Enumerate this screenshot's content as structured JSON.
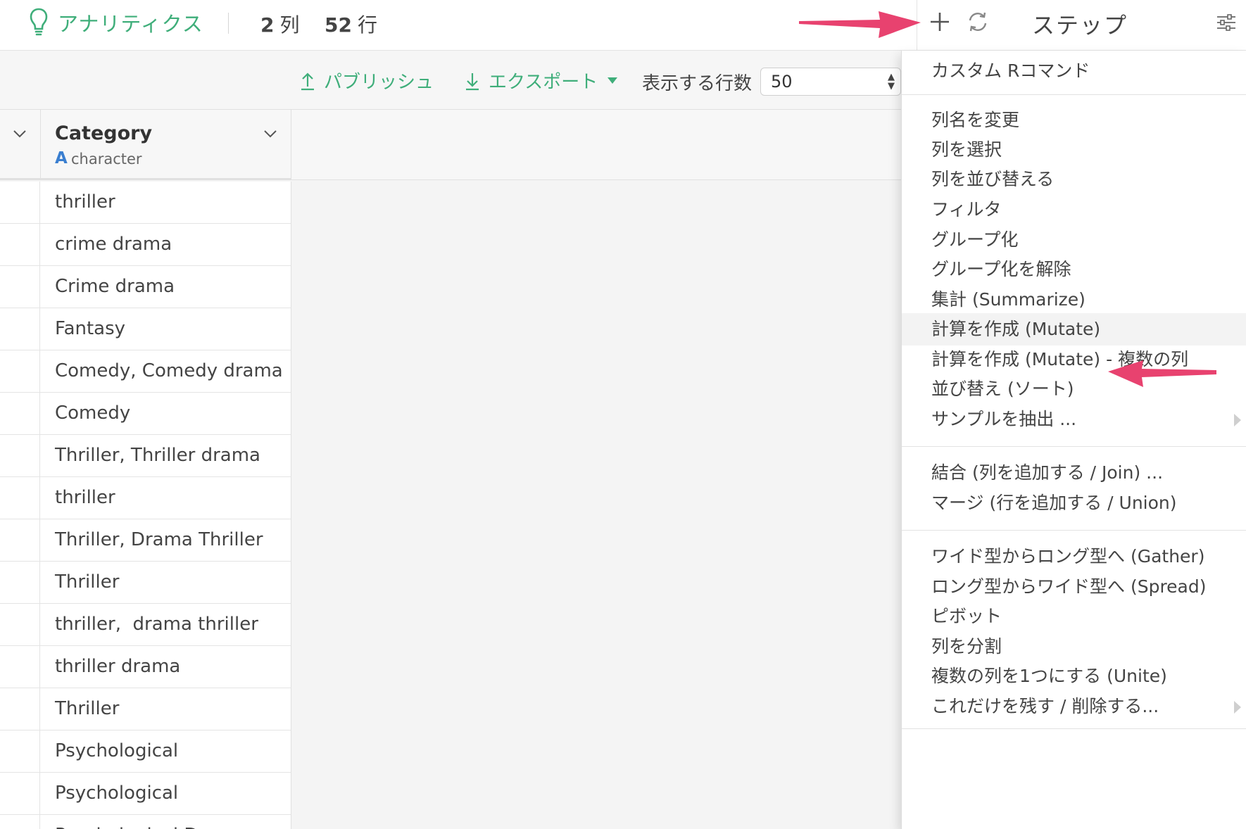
{
  "header": {
    "app_title": "アナリティクス",
    "columns_count": "2",
    "columns_unit": "列",
    "rows_count": "52",
    "rows_unit": "行",
    "steps_title": "ステップ"
  },
  "toolbar": {
    "publish_label": "パブリッシュ",
    "export_label": "エクスポート",
    "rows_label": "表示する行数",
    "rows_value": "50"
  },
  "table": {
    "column": {
      "name": "Category",
      "type_icon": "A",
      "type": "character"
    },
    "rows": [
      "thriller",
      "crime drama",
      "Crime drama",
      "Fantasy",
      "Comedy, Comedy drama",
      "Comedy",
      "Thriller, Thriller drama",
      "thriller",
      "Thriller, Drama Thriller",
      "Thriller",
      "thriller,  drama thriller",
      "thriller drama",
      "Thriller",
      "Psychological",
      "Psychological",
      "Psychological Drama"
    ]
  },
  "menu": {
    "items": [
      "カスタム Rコマンド",
      "列名を変更",
      "列を選択",
      "列を並び替える",
      "フィルタ",
      "グループ化",
      "グループ化を解除",
      "集計 (Summarize)",
      "計算を作成 (Mutate)",
      "計算を作成 (Mutate) - 複数の列",
      "並び替え (ソート)",
      "サンプルを抽出 ...",
      "結合 (列を追加する / Join) ...",
      "マージ (行を追加する / Union)",
      "ワイド型からロング型へ (Gather)",
      "ロング型からワイド型へ (Spread)",
      "ピボット",
      "列を分割",
      "複数の列を1つにする (Unite)",
      "これだけを残す / 削除する..."
    ],
    "highlighted_index": 8
  },
  "colors": {
    "accent_green": "#3fae7a",
    "type_blue": "#3a7fd0",
    "annotation_pink": "#e8426f"
  },
  "icons": {
    "logo": "lightbulb-icon",
    "add": "plus-icon",
    "refresh": "refresh-icon",
    "settings": "sliders-icon",
    "publish": "upload-arrow-icon",
    "export": "download-arrow-icon"
  }
}
